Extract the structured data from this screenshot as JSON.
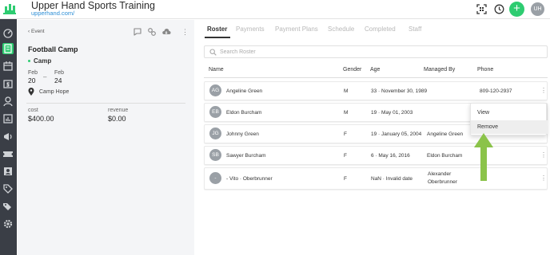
{
  "colors": {
    "accent": "#2ecc71",
    "rail": "#3a3e46",
    "link": "#2d8fd6",
    "tab_inactive": "#b8b8b8",
    "arrow": "#8bc34a"
  },
  "header": {
    "title": "Upper Hand Sports Training",
    "url": "upperhand.com/",
    "user_initials": "UH",
    "add_label": "+",
    "icons": [
      "qr-scan-icon",
      "clock-icon",
      "add-icon"
    ]
  },
  "rail": {
    "icons": [
      "dashboard-icon",
      "calendar-book-icon",
      "calendar-icon",
      "calendar-dollar-icon",
      "events-icon",
      "reports-icon",
      "marketing-icon",
      "ticket-icon",
      "contacts-icon",
      "tag-icon",
      "tags-icon",
      "settings-icon"
    ]
  },
  "event_panel": {
    "back_label": "Event",
    "title": "Football Camp",
    "type": "Camp",
    "start_month": "Feb",
    "start_day": "20",
    "end_month": "Feb",
    "end_day": "24",
    "date_separator": "–",
    "location": "Camp Hope",
    "cost_label": "cost",
    "cost_value": "$400.00",
    "revenue_label": "revenue",
    "revenue_value": "$0.00"
  },
  "tabs": [
    "Roster",
    "Payments",
    "Payment Plans",
    "Schedule",
    "Completed",
    "Staff"
  ],
  "search": {
    "placeholder": "Search Roster"
  },
  "columns": [
    "Name",
    "Gender",
    "Age",
    "Managed By",
    "Phone"
  ],
  "rows": [
    {
      "initials": "AG",
      "name": "Angeline Green",
      "gender": "M",
      "age": "33 · November 30, 1989",
      "managed_by": "",
      "phone": "809-120-2937"
    },
    {
      "initials": "EB",
      "name": "Eldon Burcham",
      "gender": "M",
      "age": "19 · May 01, 2003",
      "managed_by": "",
      "phone": ""
    },
    {
      "initials": "JG",
      "name": "Johnny Green",
      "gender": "F",
      "age": "19 · January 05, 2004",
      "managed_by": "Angeline Green",
      "phone": ""
    },
    {
      "initials": "SB",
      "name": "Sawyer Burcham",
      "gender": "F",
      "age": "6 · May 16, 2016",
      "managed_by": "Eldon Burcham",
      "phone": ""
    },
    {
      "initials": "-",
      "name": "- Vito · Oberbrunner",
      "gender": "F",
      "age": "NaN · Invalid date",
      "managed_by": "Alexander Oberbrunner",
      "managed_by_1": "Alexander",
      "managed_by_2": "Oberbrunner",
      "phone": ""
    }
  ],
  "row_menu": {
    "items": [
      "View",
      "Remove"
    ],
    "hovered": "Remove"
  }
}
